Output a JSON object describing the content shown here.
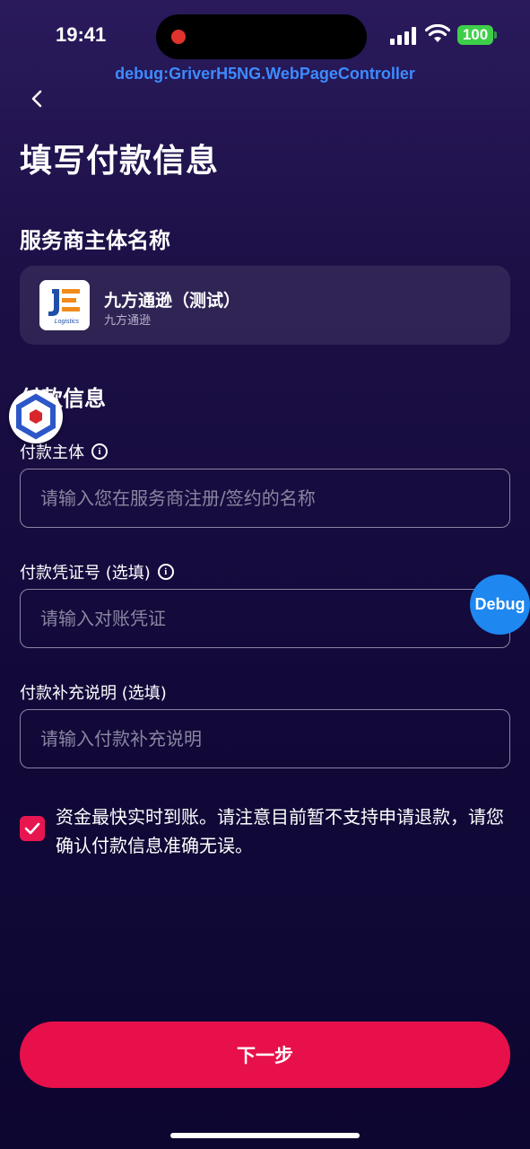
{
  "status_bar": {
    "time": "19:41",
    "battery": "100"
  },
  "debug_banner": "debug:GriverH5NG.WebPageController",
  "header": {
    "back_icon": "chevron-left-icon",
    "title": "填写付款信息"
  },
  "merchant_section": {
    "heading": "服务商主体名称",
    "name": "九方通逊（测试）",
    "sub": "九方通逊",
    "logo_text": "JE",
    "logo_sub": "Logistics"
  },
  "payment_section": {
    "heading": "付款信息"
  },
  "fields": {
    "payer": {
      "label": "付款主体",
      "placeholder": "请输入您在服务商注册/签约的名称",
      "value": ""
    },
    "voucher": {
      "label": "付款凭证号 (选填)",
      "placeholder": "请输入对账凭证",
      "value": ""
    },
    "note": {
      "label": "付款补充说明 (选填)",
      "placeholder": "请输入付款补充说明",
      "value": ""
    }
  },
  "agreement": {
    "checked": true,
    "text": "资金最快实时到账。请注意目前暂不支持申请退款，请您确认付款信息准确无误。"
  },
  "debug_fab": "Debug",
  "next_button": "下一步",
  "colors": {
    "accent": "#e8104a",
    "debug_blue": "#1e87f0",
    "battery_green": "#3ecf4a"
  }
}
